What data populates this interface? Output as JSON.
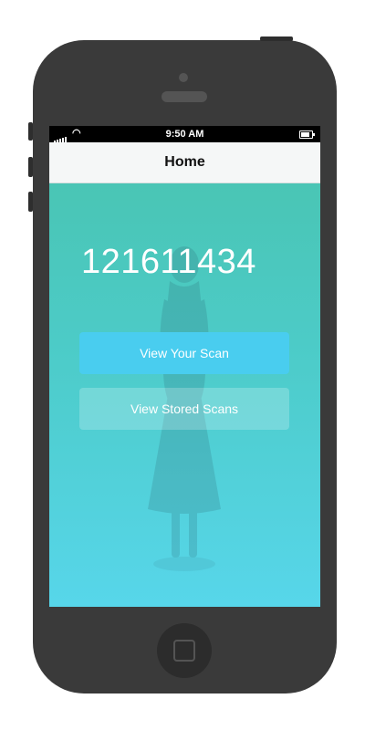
{
  "status_bar": {
    "time": "9:50 AM"
  },
  "nav": {
    "title": "Home"
  },
  "main": {
    "scan_number": "121611434",
    "view_scan_label": "View Your Scan",
    "view_stored_label": "View Stored Scans"
  },
  "colors": {
    "gradient_top": "#49c3ae",
    "gradient_bottom": "#57d6ea",
    "primary_button": "#49cdef",
    "phone_body": "#3a3a3a"
  },
  "icons": [
    "signal-icon",
    "wifi-icon",
    "battery-icon",
    "home-button-icon"
  ]
}
